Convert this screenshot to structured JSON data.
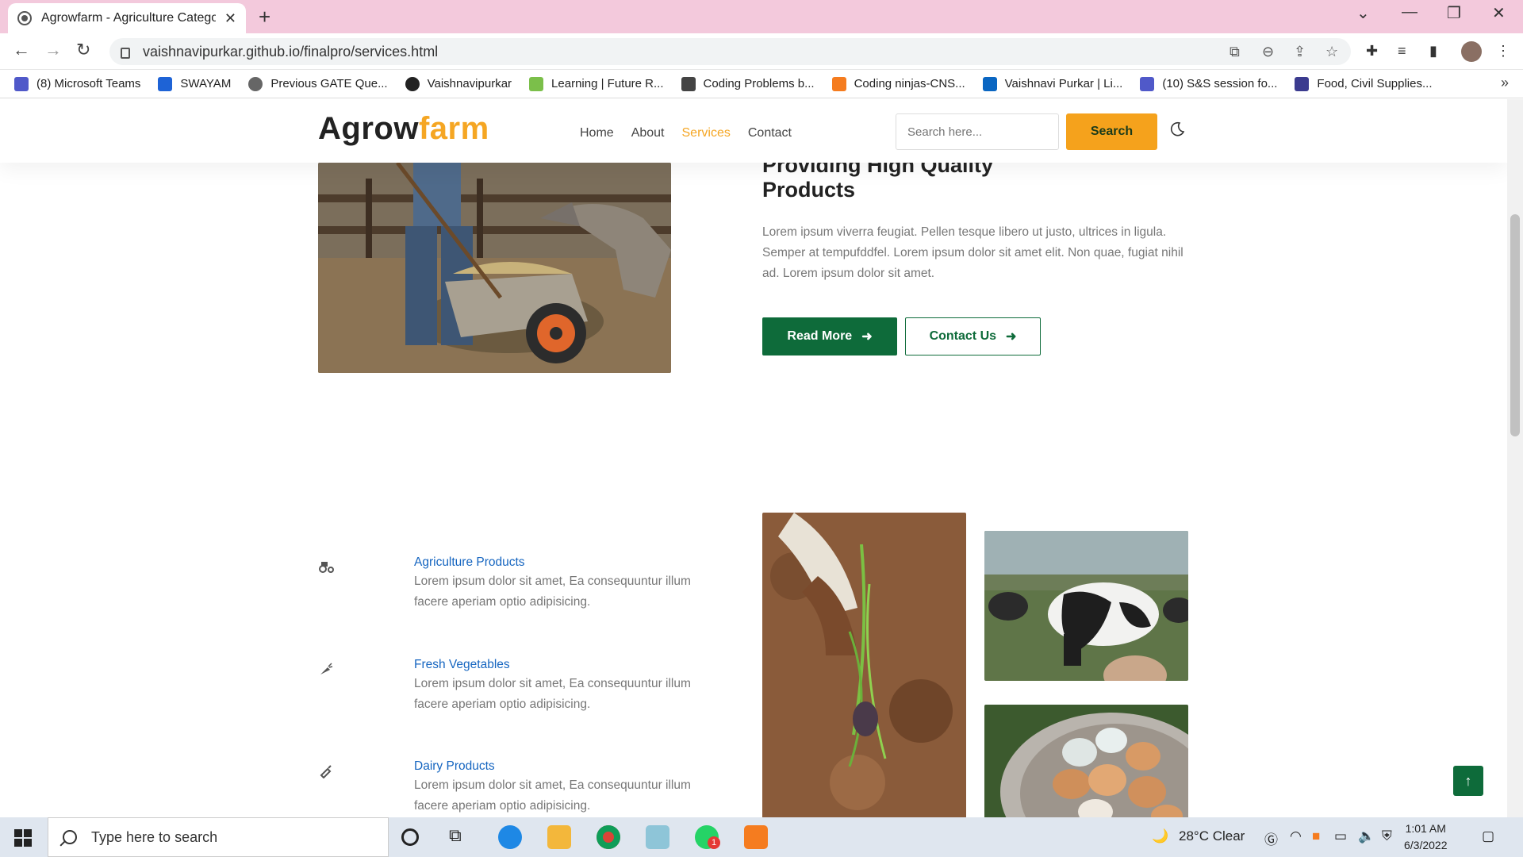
{
  "browser": {
    "tab_title": "Agrowfarm - Agriculture Category",
    "url": "vaishnavipurkar.github.io/finalpro/services.html",
    "bookmarks": [
      {
        "label": "(8) Microsoft Teams",
        "color": "#5059c9"
      },
      {
        "label": "SWAYAM",
        "color": "#1e63d6"
      },
      {
        "label": "Previous GATE Que...",
        "color": "#666666"
      },
      {
        "label": "Vaishnavipurkar",
        "color": "#222222"
      },
      {
        "label": "Learning | Future R...",
        "color": "#7bbf4a"
      },
      {
        "label": "Coding Problems b...",
        "color": "#444444"
      },
      {
        "label": "Coding ninjas-CNS...",
        "color": "#f57c1f"
      },
      {
        "label": "Vaishnavi Purkar | Li...",
        "color": "#0a66c2"
      },
      {
        "label": "(10) S&S session fo...",
        "color": "#5059c9"
      },
      {
        "label": "Food, Civil Supplies...",
        "color": "#3b3b8f"
      }
    ]
  },
  "site": {
    "logo_main": "Agrow",
    "logo_accent": "farm",
    "nav": {
      "home": "Home",
      "about": "About",
      "services": "Services",
      "contact": "Contact"
    },
    "search_placeholder": "Search here...",
    "search_button": "Search"
  },
  "hero": {
    "title_line1": "Providing High Quality",
    "title_line2": "Products",
    "text": "Lorem ipsum viverra feugiat. Pellen tesque libero ut justo, ultrices in ligula. Semper at tempufddfel. Lorem ipsum dolor sit amet elit. Non quae, fugiat nihil ad. Lorem ipsum dolor sit amet.",
    "read_more": "Read More",
    "contact_us": "Contact Us"
  },
  "services": [
    {
      "title": "Agriculture Products",
      "desc": "Lorem ipsum dolor sit amet, Ea consequuntur illum facere aperiam optio adipisicing."
    },
    {
      "title": "Fresh Vegetables",
      "desc": "Lorem ipsum dolor sit amet, Ea consequuntur illum facere aperiam optio adipisicing."
    },
    {
      "title": "Dairy Products",
      "desc": "Lorem ipsum dolor sit amet, Ea consequuntur illum facere aperiam optio adipisicing."
    }
  ],
  "taskbar": {
    "search_placeholder": "Type here to search",
    "weather": "28°C  Clear",
    "time": "1:01 AM",
    "date": "6/3/2022",
    "whatsapp_badge": "1"
  },
  "colors": {
    "accent": "#f5a623",
    "brand_green": "#0e6b3a",
    "link_blue": "#1565c0"
  }
}
